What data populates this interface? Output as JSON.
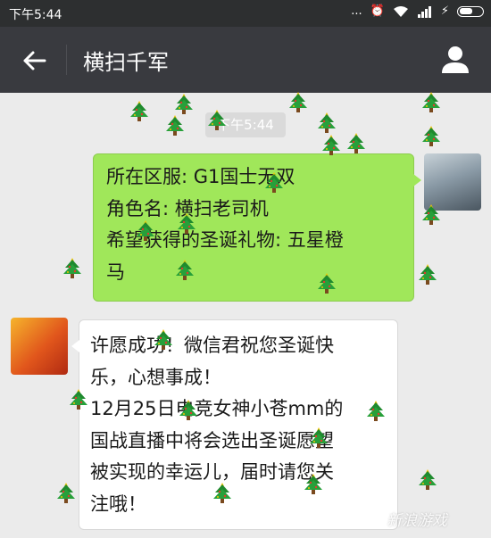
{
  "status_bar": {
    "time": "下午5:44",
    "dots": "..."
  },
  "header": {
    "title": "横扫千军"
  },
  "chat": {
    "timestamp": "下午5:44",
    "messages": [
      {
        "sender": "user",
        "lines": [
          "所在区服: G1国士无双",
          "角色名: 横扫老司机",
          "希望获得的圣诞礼物: 五星橙",
          "马"
        ]
      },
      {
        "sender": "bot",
        "lines": [
          "许愿成功！微信君祝您圣诞快",
          "乐，心想事成！",
          "12月25日电竞女神小苍mm的",
          "国战直播中将会选出圣诞愿望",
          "被实现的幸运儿，届时请您关",
          "注哦！"
        ]
      }
    ]
  },
  "watermark": "新浪游戏",
  "colors": {
    "navbar": "#393a3f",
    "sent_bubble": "#a0e75a",
    "received_bubble": "#ffffff",
    "background": "#ebebeb"
  },
  "icons": {
    "back": "arrow-left-icon",
    "contact": "person-icon",
    "decoration": "christmas-tree-icon"
  }
}
